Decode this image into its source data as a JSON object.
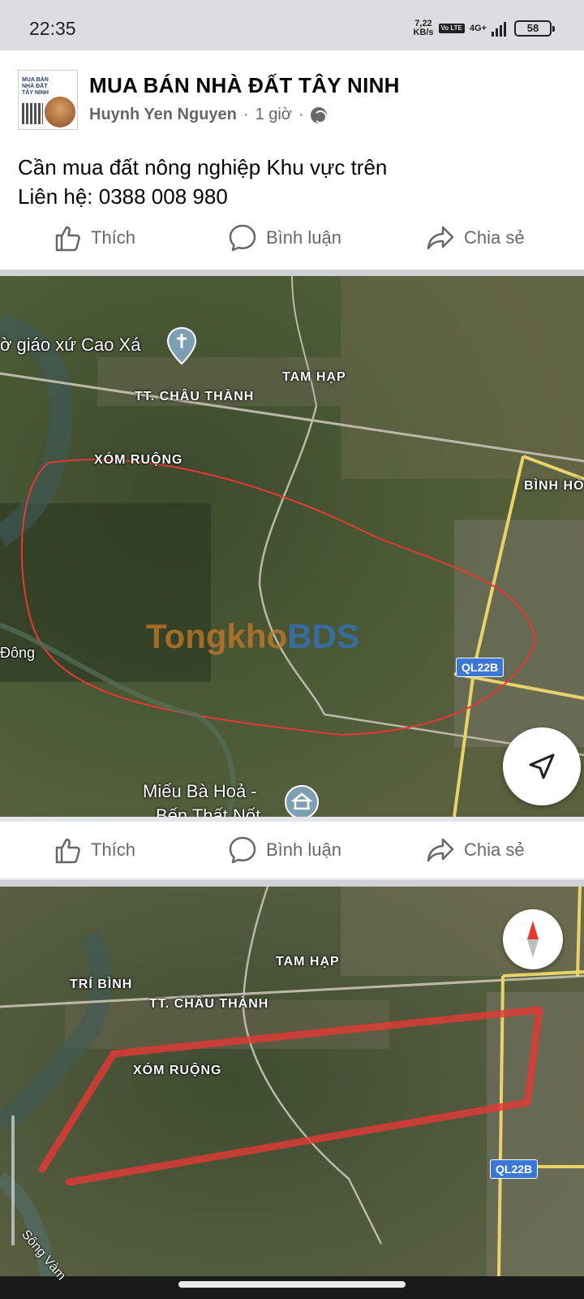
{
  "status_bar": {
    "time": "22:35",
    "speed": "7,22",
    "speed_unit": "KB/s",
    "volte": "Vo LTE",
    "network": "4G+",
    "battery": "58"
  },
  "post": {
    "group_name": "MUA BÁN NHÀ ĐẤT TÂY NINH",
    "author": "Huynh Yen Nguyen",
    "time_ago": "1 giờ",
    "separator": "·",
    "avatar_text": "MUA BÁN NHÀ ĐẤT TÂY NINH",
    "text_line1": "Cần mua đất nông nghiệp Khu vực trên",
    "text_line2": "Liên hệ: 0388 008 980"
  },
  "actions": {
    "like": "Thích",
    "comment": "Bình luận",
    "share": "Chia sẻ"
  },
  "map1": {
    "labels": {
      "church": "ờ giáo xứ Cao Xá",
      "tam_hap": "TAM HẠP",
      "chau_thanh": "TT. CHÂU THÀNH",
      "xom_ruong": "XÓM RUỘNG",
      "binh_ho": "BÌNH HÒ",
      "dong": "Đông",
      "road": "QL22B",
      "mieu_1": "Miếu Bà Hoả -",
      "mieu_2": "Bến Thất Nốt"
    },
    "watermark_a": "Tongkho",
    "watermark_b": "BDS"
  },
  "map2": {
    "labels": {
      "tam_hap": "TAM HẠP",
      "tri_binh": "TRÍ BÌNH",
      "chau_thanh": "TT. CHÂU THÀNH",
      "xom_ruong": "XÓM RUỘNG",
      "road": "QL22B",
      "song": "Sông Vàm"
    }
  },
  "colors": {
    "facebook_gray": "#65676b",
    "outline_red": "#e53935",
    "road_blue": "#3b77d4"
  }
}
